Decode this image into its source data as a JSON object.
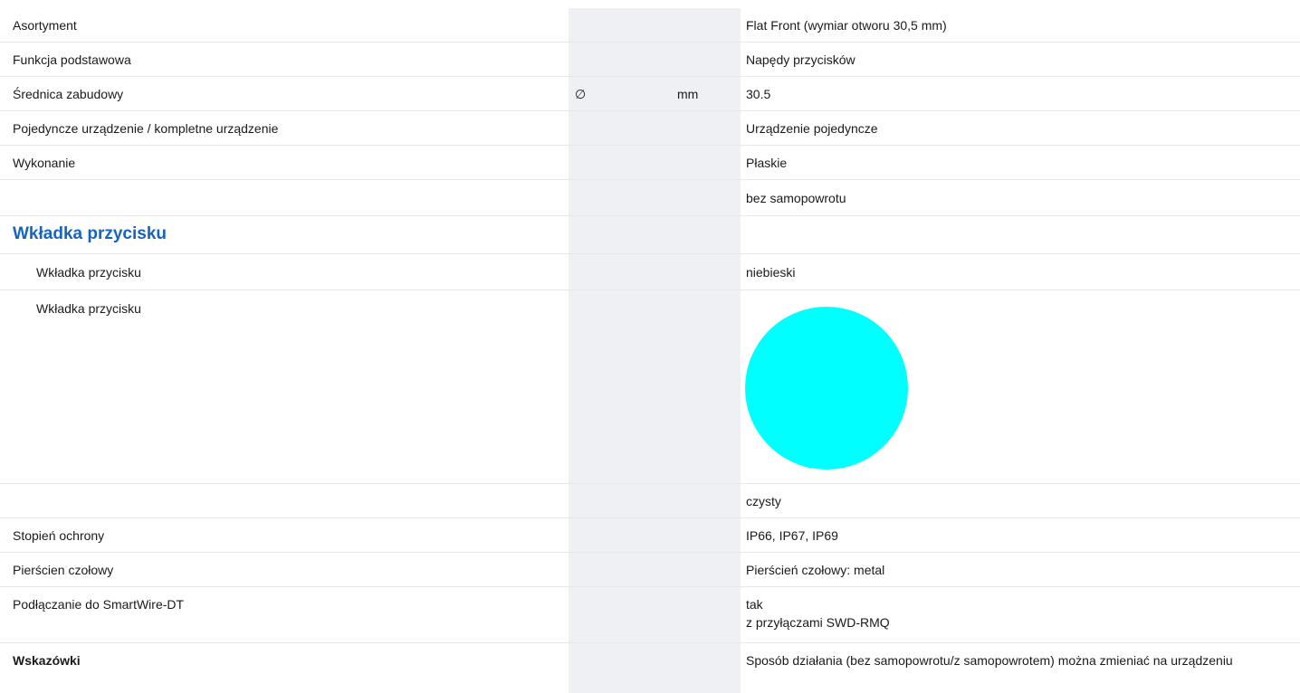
{
  "rows": {
    "asortyment": {
      "label": "Asortyment",
      "value": "Flat Front (wymiar otworu 30,5 mm)"
    },
    "funkcja": {
      "label": "Funkcja podstawowa",
      "value": "Napędy przycisków"
    },
    "srednica": {
      "label": "Średnica zabudowy",
      "symbol": "∅",
      "unit": "mm",
      "value": "30.5"
    },
    "pojedyncze": {
      "label": "Pojedyncze urządzenie / kompletne urządzenie",
      "value": "Urządzenie pojedyncze"
    },
    "wykonanie": {
      "label": "Wykonanie",
      "value": "Płaskie"
    },
    "samopowrot": {
      "label": "",
      "value": "bez samopowrotu"
    }
  },
  "section": {
    "title": "Wkładka przycisku"
  },
  "insert": {
    "row1": {
      "label": "Wkładka przycisku",
      "value": "niebieski"
    },
    "row2": {
      "label": "Wkładka przycisku"
    },
    "color_swatch": "#00ffff",
    "row3": {
      "label": "",
      "value": "czysty"
    }
  },
  "rows2": {
    "ochrona": {
      "label": "Stopień ochrony",
      "value": "IP66, IP67, IP69"
    },
    "pierscien": {
      "label": "Pierścien czołowy",
      "value": "Pierścień czołowy: metal"
    },
    "smartwire": {
      "label": "Podłączanie do SmartWire-DT",
      "value_line1": "tak",
      "value_line2": "z przyłączami SWD-RMQ"
    },
    "wskazowki": {
      "label": "Wskazówki",
      "value": "Sposób działania (bez samopowrotu/z samopowrotem) można zmieniać na urządzeniu"
    }
  }
}
